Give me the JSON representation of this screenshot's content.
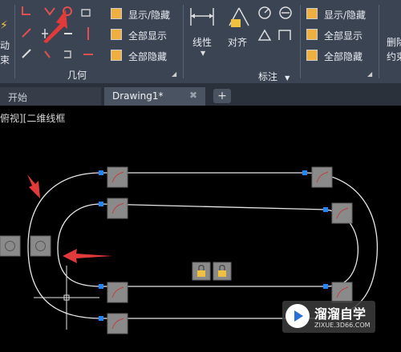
{
  "ribbon": {
    "left_edge_labels": [
      "动",
      "束"
    ],
    "geometry_panel": {
      "title": "几何",
      "show_hide": "显示/隐藏",
      "show_all": "全部显示",
      "hide_all": "全部隐藏"
    },
    "dimension_panel": {
      "title": "标注",
      "linear": "线性",
      "aligned": "对齐",
      "show_hide": "显示/隐藏",
      "show_all": "全部显示",
      "hide_all": "全部隐藏"
    },
    "right_edge_labels": [
      "删除",
      "约束"
    ]
  },
  "tabs": [
    {
      "label": "开始",
      "active": false
    },
    {
      "label": "Drawing1*",
      "active": true
    }
  ],
  "viewport": {
    "label": "俯视][二维线框"
  },
  "watermark": {
    "title": "溜溜自学",
    "url": "ZIXUE.3D66.COM"
  },
  "colors": {
    "ribbon": "#3b4453",
    "canvas": "#000000",
    "accent": "#e23a3a",
    "grip": "#1e88ff"
  }
}
